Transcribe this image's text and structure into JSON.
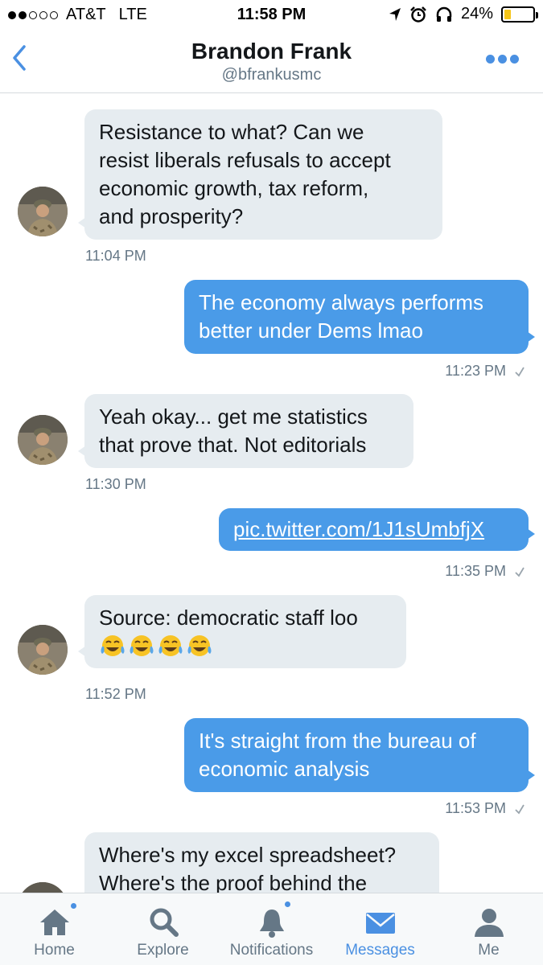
{
  "status_bar": {
    "carrier": "AT&T",
    "network": "LTE",
    "time": "11:58 PM",
    "battery_percent_label": "24%",
    "battery_level": 0.24,
    "signal_bars_filled": 2,
    "signal_bars_total": 5,
    "icons": [
      "location-arrow-icon",
      "alarm-icon",
      "headphones-icon",
      "battery-icon"
    ]
  },
  "header": {
    "title": "Brandon Frank",
    "handle": "@bfrankusmc",
    "back_icon": "chevron-left-icon",
    "more_icon": "more-dots-icon"
  },
  "messages": [
    {
      "direction": "in",
      "lines": [
        "Resistance to what? Can we",
        "resist liberals refusals to accept",
        "economic growth, tax reform,",
        "and prosperity?"
      ],
      "time": "11:04 PM"
    },
    {
      "direction": "out",
      "lines": [
        "The economy always performs",
        "better under Dems lmao"
      ],
      "time": "11:23 PM"
    },
    {
      "direction": "in",
      "lines": [
        "Yeah okay... get me statistics",
        "that prove that. Not editorials"
      ],
      "time": "11:30 PM"
    },
    {
      "direction": "out",
      "link": "pic.twitter.com/1J1sUmbfjX",
      "time": "11:35 PM"
    },
    {
      "direction": "in",
      "lines": [
        "Source: democratic staff loo"
      ],
      "emoji": [
        "face-with-tears-of-joy",
        "face-with-tears-of-joy",
        "face-with-tears-of-joy",
        "face-with-tears-of-joy"
      ],
      "time": "11:52 PM"
    },
    {
      "direction": "out",
      "lines": [
        "It's straight from the bureau of",
        "economic analysis"
      ],
      "time": "11:53 PM"
    },
    {
      "direction": "in",
      "lines": [
        "Where's my excel spreadsheet?",
        "Where's the proof behind the"
      ]
    }
  ],
  "tab_bar": {
    "tabs": [
      {
        "label": "Home",
        "icon": "home-icon",
        "has_dot": true
      },
      {
        "label": "Explore",
        "icon": "search-icon",
        "has_dot": false
      },
      {
        "label": "Notifications",
        "icon": "bell-icon",
        "has_dot": true
      },
      {
        "label": "Messages",
        "icon": "envelope-icon",
        "active": true
      },
      {
        "label": "Me",
        "icon": "person-icon",
        "has_dot": false
      }
    ]
  },
  "colors": {
    "accent": "#4a90e2",
    "outgoing_bubble": "#4a9be8",
    "incoming_bubble": "#e6ecf0",
    "secondary_text": "#657786"
  }
}
